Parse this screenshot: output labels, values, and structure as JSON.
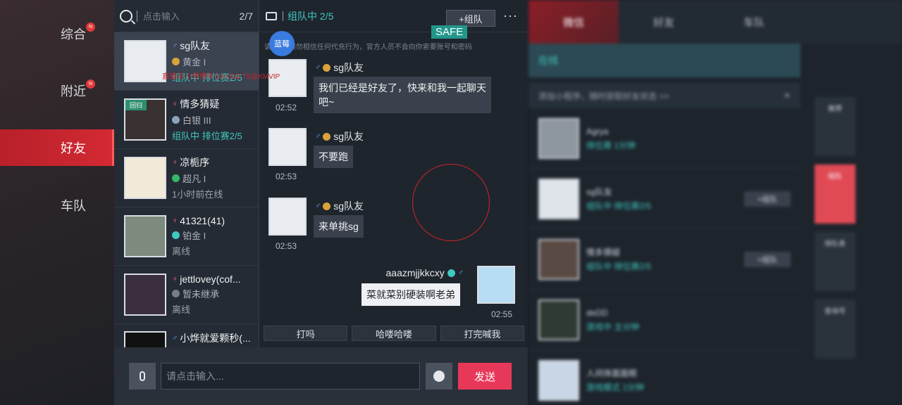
{
  "nav": {
    "items": [
      {
        "label": "综合",
        "badge": "N"
      },
      {
        "label": "附近",
        "badge": "N"
      },
      {
        "label": "好友",
        "active": true
      },
      {
        "label": "车队"
      }
    ]
  },
  "friend_list": {
    "search_placeholder": "点击输入",
    "count": "2/7",
    "friends": [
      {
        "name": "sg队友",
        "gender": "male",
        "rank": "黄金 I",
        "rank_color": "#d9a23a",
        "status": "组队中 排位赛2/5",
        "status_type": "team",
        "selected": true
      },
      {
        "name": "情多猜疑",
        "gender": "female",
        "rank": "白银 III",
        "rank_color": "#8fa3b8",
        "status": "组队中 排位赛2/5",
        "status_type": "team",
        "tag": "回归"
      },
      {
        "name": "凉栀序",
        "gender": "female",
        "rank": "超凡 I",
        "rank_color": "#33b86a",
        "status": "1小时前在线",
        "status_type": "offline"
      },
      {
        "name": "41321(41)",
        "gender": "female",
        "rank": "铂金 I",
        "rank_color": "#3fc7c0",
        "status": "离线",
        "status_type": "offline"
      },
      {
        "name": "jettlovey(cof...",
        "gender": "female",
        "rank": "暂未继承",
        "rank_color": "#777e88",
        "status": "离线",
        "status_type": "offline"
      },
      {
        "name": "小烨就爱颗秒(...",
        "gender": "male",
        "rank": "",
        "rank_color": "#777e88",
        "status": "",
        "status_type": "offline"
      }
    ]
  },
  "chat": {
    "header_title": "组队中 2/5",
    "team_button": "+组队",
    "more_label": "···",
    "safe_label": "SAFE",
    "notice": "请勿相信任何代充行为，官方人员不会向你索要账号和密码",
    "notice_prefix": "请",
    "lanmei_label": "蓝莓",
    "watermark": "直播间:小博博帅 (Ver333 TS@KMVIP",
    "messages": [
      {
        "name": "sg队友",
        "text_line1": "我们已经是好友了，快来和我一起聊天",
        "text_line2": "吧~",
        "time": "02:52"
      },
      {
        "name": "sg队友",
        "text": "不要跑",
        "time": "02:53"
      },
      {
        "name": "sg队友",
        "text": "来单挑sg",
        "time": "02:53"
      },
      {
        "name": "aaazmjjkkcxy",
        "text": "菜就菜别硬装啊老弟",
        "time": "02:55",
        "mine": true
      }
    ],
    "quick_replies": [
      "打吗",
      "哈喽哈喽",
      "打完喊我"
    ]
  },
  "input": {
    "placeholder": "请点击输入...",
    "send_label": "发送"
  },
  "right_panel": {
    "tabs": [
      "微信",
      "好友",
      "车队"
    ],
    "online_label": "在线",
    "tip": "添加小程序，随时获取好友状态 >>",
    "close_label": "✕",
    "rows": [
      {
        "name": "Agrya",
        "line2": "排位赛 1分钟"
      },
      {
        "name": "sg队友",
        "line2": "组队中 排位赛2/5",
        "button": "+组队"
      },
      {
        "name": "情多猜疑",
        "line2": "组队中 排位赛2/5",
        "button": "+组队"
      },
      {
        "name": "deDD",
        "line2": "游戏中 主分钟"
      },
      {
        "name": "人间体面面眼",
        "line2": "游戏模式 1分钟"
      }
    ],
    "side_buttons": [
      "推荐",
      "组队",
      "排队表",
      "查询号"
    ]
  }
}
